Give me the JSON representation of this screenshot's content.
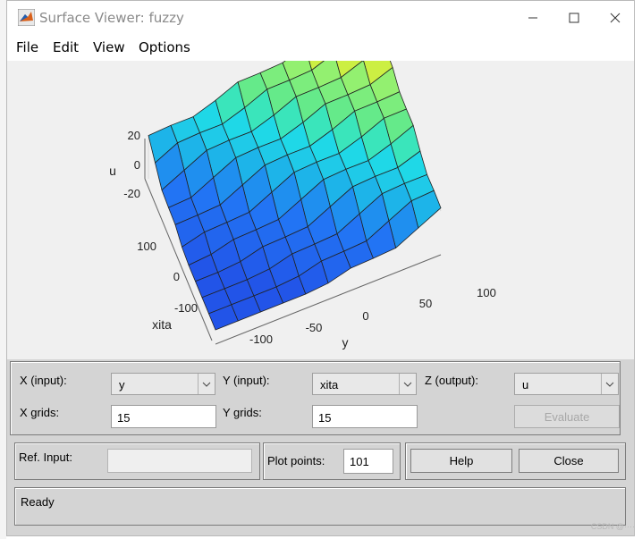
{
  "window": {
    "title": "Surface Viewer: fuzzy"
  },
  "menu": [
    "File",
    "Edit",
    "View",
    "Options"
  ],
  "plot": {
    "zlabel": "u",
    "xlabel": "y",
    "ylabel": "xita",
    "zticks": [
      "20",
      "0",
      "-20"
    ],
    "xticks": [
      "-100",
      "-50",
      "0",
      "50",
      "100"
    ],
    "yticks": [
      "100",
      "0",
      "-100"
    ]
  },
  "controls": {
    "x_input_label": "X (input):",
    "x_input_value": "y",
    "y_input_label": "Y (input):",
    "y_input_value": "xita",
    "z_output_label": "Z (output):",
    "z_output_value": "u",
    "x_grids_label": "X grids:",
    "x_grids_value": "15",
    "y_grids_label": "Y grids:",
    "y_grids_value": "15",
    "evaluate_label": "Evaluate",
    "ref_input_label": "Ref. Input:",
    "ref_input_value": "",
    "plot_points_label": "Plot points:",
    "plot_points_value": "101",
    "help_label": "Help",
    "close_label": "Close"
  },
  "status": {
    "text": "Ready"
  },
  "watermark": "CSDN @····"
}
